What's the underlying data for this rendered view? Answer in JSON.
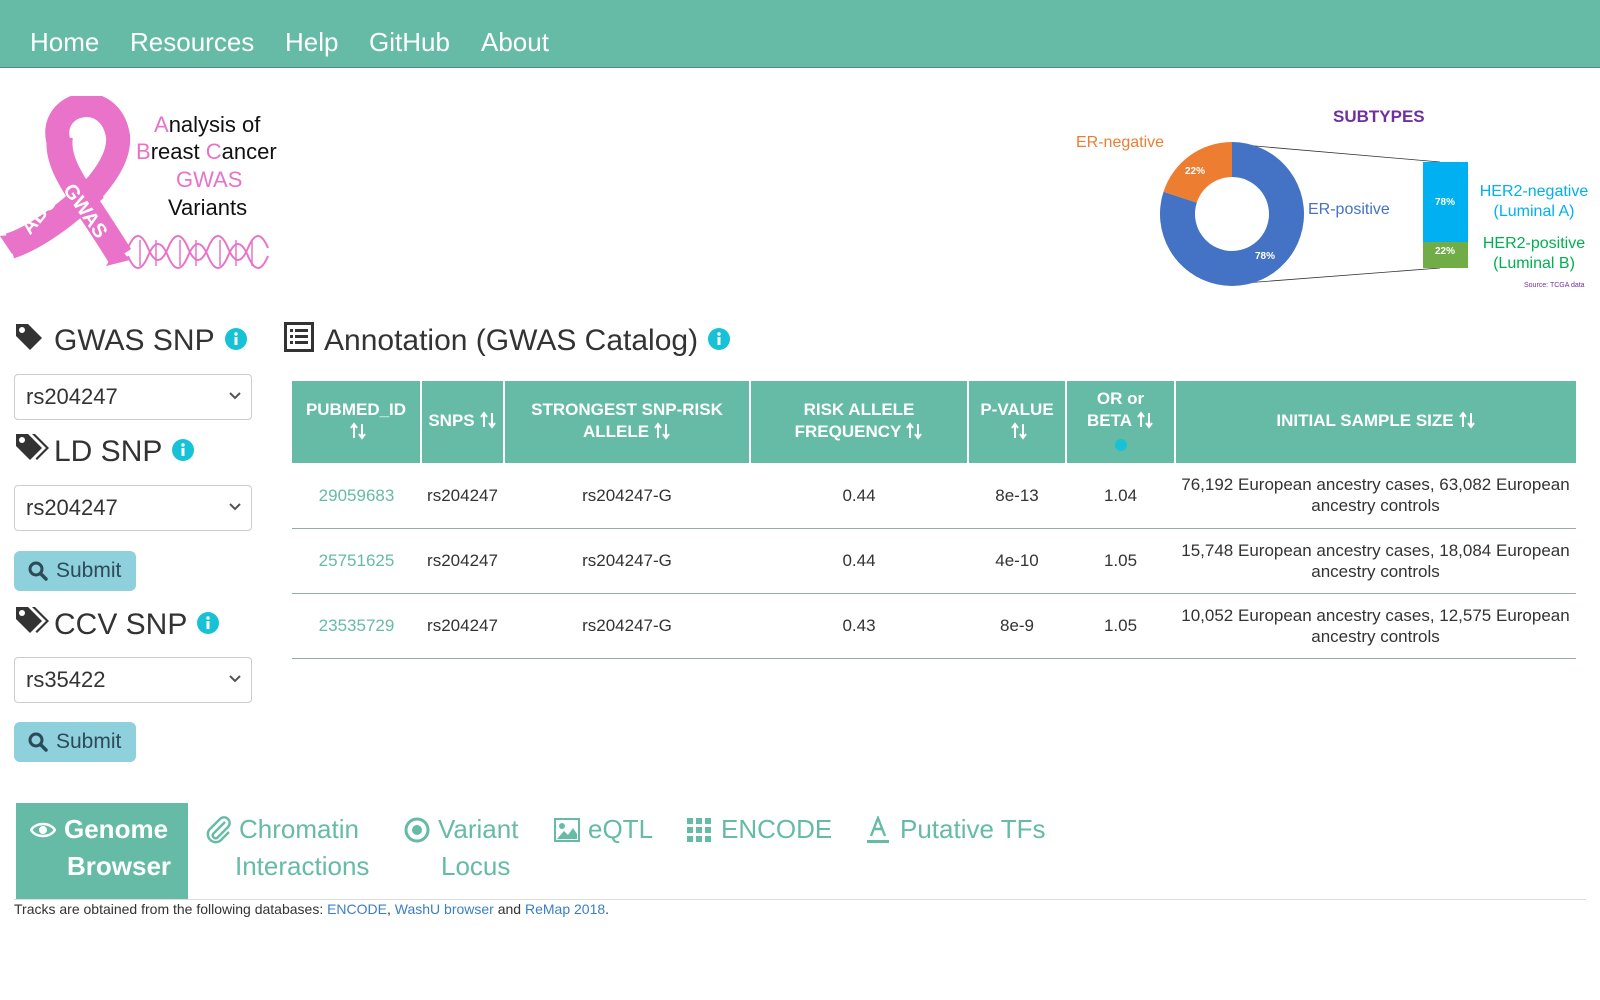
{
  "nav": {
    "items": [
      "Home",
      "Resources",
      "Help",
      "GitHub",
      "About"
    ]
  },
  "logo": {
    "line1_initial": "A",
    "line1_rest": "nalysis of",
    "line2_initial": "B",
    "line2_mid": "reast ",
    "line2_initial2": "C",
    "line2_rest": "ancer",
    "line3": "GWAS",
    "line4": "Variants",
    "ribbon_text_left": "ABC",
    "ribbon_text_right": "GWAS"
  },
  "subtypes_figure": {
    "title": "SUBTYPES",
    "er_negative_label": "ER-negative",
    "er_positive_label": "ER-positive",
    "er_negative_pct": "22%",
    "er_positive_pct": "78%",
    "her2_negative_label_1": "HER2-negative",
    "her2_negative_label_2": "(Luminal A)",
    "her2_positive_label_1": "HER2-positive",
    "her2_positive_label_2": "(Luminal B)",
    "her2_negative_pct": "78%",
    "her2_positive_pct": "22%",
    "source": "Source: TCGA data",
    "colors": {
      "er_negative": "#ed7d31",
      "er_positive": "#4472c4",
      "her2_negative": "#00b0f0",
      "her2_positive": "#70ad47",
      "title": "#7030a0"
    }
  },
  "left_panel": {
    "gwas_snp": {
      "title": "GWAS SNP",
      "value": "rs204247"
    },
    "ld_snp": {
      "title": "LD SNP",
      "value": "rs204247"
    },
    "ccv_snp": {
      "title": "CCV SNP",
      "value": "rs35422"
    },
    "submit_label": "Submit"
  },
  "annotation": {
    "title": "Annotation (GWAS Catalog)",
    "columns": {
      "pubmed": "PUBMED_ID",
      "snps": "SNPS",
      "strongest": "STRONGEST SNP-RISK ALLELE",
      "raf": "RISK ALLELE FREQUENCY",
      "pvalue": "P-VALUE",
      "or_beta": "OR or BETA",
      "sample": "INITIAL SAMPLE SIZE"
    },
    "rows": [
      {
        "pubmed": "29059683",
        "snps": "rs204247",
        "strongest": "rs204247-G",
        "raf": "0.44",
        "pvalue": "8e-13",
        "or_beta": "1.04",
        "sample": "76,192 European ancestry cases, 63,082 European ancestry controls"
      },
      {
        "pubmed": "25751625",
        "snps": "rs204247",
        "strongest": "rs204247-G",
        "raf": "0.44",
        "pvalue": "4e-10",
        "or_beta": "1.05",
        "sample": "15,748 European ancestry cases, 18,084 European ancestry controls"
      },
      {
        "pubmed": "23535729",
        "snps": "rs204247",
        "strongest": "rs204247-G",
        "raf": "0.43",
        "pvalue": "8e-9",
        "or_beta": "1.05",
        "sample": "10,052 European ancestry cases, 12,575 European ancestry controls"
      }
    ]
  },
  "tabs": {
    "genome_browser_1": "Genome",
    "genome_browser_2": "Browser",
    "chromatin_1": "Chromatin",
    "chromatin_2": "Interactions",
    "variant_1": "Variant",
    "variant_2": "Locus",
    "eqtl": "eQTL",
    "encode": "ENCODE",
    "putative_tfs": "Putative TFs"
  },
  "footer": {
    "prefix": "Tracks are obtained from the following databases: ",
    "link1": "ENCODE",
    "sep1": ", ",
    "link2": "WashU browser",
    "sep2": " and ",
    "link3": "ReMap 2018",
    "suffix": "."
  },
  "colors": {
    "accent": "#66bba6",
    "info": "#17c2d6",
    "button": "#8ed0dc"
  }
}
